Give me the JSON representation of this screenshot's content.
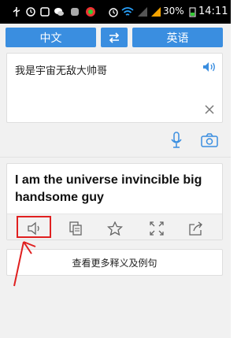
{
  "status_bar": {
    "battery_percent": "30%",
    "time": "14:11",
    "icons": [
      "usb-icon",
      "alarm-icon",
      "notification-icon",
      "chat-icon",
      "app-icon",
      "wifi-icon",
      "signal-icon",
      "battery-icon"
    ]
  },
  "lang_bar": {
    "source": "中文",
    "target": "英语",
    "swap_icon": "swap-arrows-icon"
  },
  "input": {
    "text": "我是宇宙无敌大帅哥"
  },
  "result": {
    "text": "I am the universe invincible big handsome guy",
    "toolbar_icons": [
      "speaker-icon",
      "copy-icon",
      "star-icon",
      "fullscreen-icon",
      "share-icon"
    ]
  },
  "more_button": {
    "label": "查看更多释义及例句"
  },
  "colors": {
    "accent": "#3a8ee0",
    "highlight": "#e02020"
  }
}
